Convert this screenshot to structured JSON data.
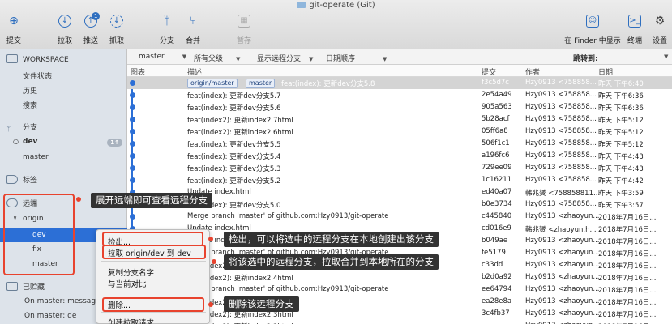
{
  "window": {
    "title": "git-operate (Git)"
  },
  "toolbar": {
    "commit": "提交",
    "pull": "拉取",
    "push": "推送",
    "push_badge": "1",
    "fetch": "抓取",
    "branch": "分支",
    "merge": "合并",
    "stash": "暂存",
    "finder": "在 Finder 中显示",
    "terminal": "终端",
    "settings": "设置"
  },
  "sidebar": {
    "workspace": "WORKSPACE",
    "file_status": "文件状态",
    "history": "历史",
    "search": "搜索",
    "branches": "分支",
    "branch_dev": "dev",
    "branch_dev_count": "1↑",
    "branch_master": "master",
    "tags": "标签",
    "remotes": "远端",
    "origin": "origin",
    "remote_dev": "dev",
    "remote_fix": "fix",
    "remote_master": "master",
    "stashes": "已贮藏",
    "stash1": "On master: message",
    "stash2": "On master: de"
  },
  "filters": {
    "branch": "master",
    "parents": "所有父级",
    "remote": "显示远程分支",
    "order": "日期顺序",
    "jump_to": "跳转到:"
  },
  "columns": {
    "graph": "图表",
    "description": "描述",
    "commit": "提交",
    "author": "作者",
    "date": "日期"
  },
  "rows": [
    {
      "tags": [
        "origin/master",
        "master"
      ],
      "desc": "feat(index): 更新dev分支5.8",
      "hash": "f3c5d7c",
      "author": "Hzy0913 <758858...",
      "date": "昨天 下午6:40"
    },
    {
      "desc": "feat(index): 更新dev分支5.7",
      "hash": "2e54a49",
      "author": "Hzy0913 <758858...",
      "date": "昨天 下午6:36"
    },
    {
      "desc": "feat(index): 更新dev分支5.6",
      "hash": "905a563",
      "author": "Hzy0913 <758858...",
      "date": "昨天 下午6:36"
    },
    {
      "desc": "feat(index2): 更新index2.7html",
      "hash": "5b28acf",
      "author": "Hzy0913 <758858...",
      "date": "昨天 下午5:12"
    },
    {
      "desc": "feat(index2): 更新index2.6html",
      "hash": "05ff6a8",
      "author": "Hzy0913 <758858...",
      "date": "昨天 下午5:12"
    },
    {
      "desc": "feat(index): 更新dev分支5.5",
      "hash": "506f1c1",
      "author": "Hzy0913 <758858...",
      "date": "昨天 下午5:12"
    },
    {
      "desc": "feat(index): 更新dev分支5.4",
      "hash": "a196fc6",
      "author": "Hzy0913 <758858...",
      "date": "昨天 下午4:43"
    },
    {
      "desc": "feat(index): 更新dev分支5.3",
      "hash": "729ee09",
      "author": "Hzy0913 <758858...",
      "date": "昨天 下午4:43"
    },
    {
      "desc": "feat(index): 更新dev分支5.2",
      "hash": "1c16211",
      "author": "Hzy0913 <758858...",
      "date": "昨天 下午4:42"
    },
    {
      "desc": "Update index.html",
      "hash": "ed40a07",
      "author": "韩兆赟 <758858811...",
      "date": "昨天 下午3:59"
    },
    {
      "desc": "feat(index): 更新dev分支5.0",
      "hash": "b0e3734",
      "author": "Hzy0913 <758858...",
      "date": "昨天 下午3:57"
    },
    {
      "desc": "Merge branch 'master' of github.com:Hzy0913/git-operate",
      "hash": "c445840",
      "author": "Hzy0913 <zhaoyun...",
      "date": "2018年7月16日..."
    },
    {
      "desc": "Update index.html",
      "hash": "cd016e9",
      "author": "韩兆赟 <zhaoyun.h...",
      "date": "2018年7月16日..."
    },
    {
      "desc": "Update index2.html",
      "hash": "b049ae",
      "author": "Hzy0913 <zhaoyun...",
      "date": "2018年7月16日..."
    },
    {
      "desc": "Merge branch 'master' of github.com:Hzy0913/git-operate",
      "hash": "fe5179",
      "author": "Hzy0913 <zhaoyun...",
      "date": "2018年7月16日..."
    },
    {
      "desc": "feat(index2): 更新index2.4html",
      "hash": "c33dd",
      "author": "Hzy0913 <zhaoyun...",
      "date": "2018年7月16日..."
    },
    {
      "desc": "feat(index2): 更新index2.4html",
      "hash": "b2d0a92",
      "author": "Hzy0913 <zhaoyun...",
      "date": "2018年7月16日..."
    },
    {
      "desc": "Merge branch 'master' of github.com:Hzy0913/git-operate",
      "hash": "ee64794",
      "author": "Hzy0913 <zhaoyun...",
      "date": "2018年7月16日..."
    },
    {
      "desc": "feat(index2): 更新index2.3html",
      "hash": "ea28e8a",
      "author": "Hzy0913 <zhaoyun...",
      "date": "2018年7月16日..."
    },
    {
      "desc": "feat(index2): 更新index2.3html",
      "hash": "3c4fb37",
      "author": "Hzy0913 <zhaoyun...",
      "date": "2018年7月16日..."
    },
    {
      "desc": "feat(index2): 更新index2.2html",
      "hash": "",
      "author": "Hzy0913 <zhaoyun...",
      "date": "2018年7月16日..."
    }
  ],
  "context_menu": {
    "checkout": "检出...",
    "pull_into": "拉取 origin/dev 到 dev",
    "copy_name": "复制分支名字",
    "diff": "与当前对比",
    "delete": "删除...",
    "create_pr": "创建拉取请求..."
  },
  "callouts": {
    "expand": "展开远端即可查看远程分支",
    "checkout": "检出，可以将选中的远程分支在本地创建出该分支",
    "pull": "将该选中的远程分支，拉取合并到本地所在的分支",
    "delete": "删除该远程分支"
  },
  "colors": {
    "accent": "#2c6fd6",
    "annotation": "#e8432e"
  }
}
